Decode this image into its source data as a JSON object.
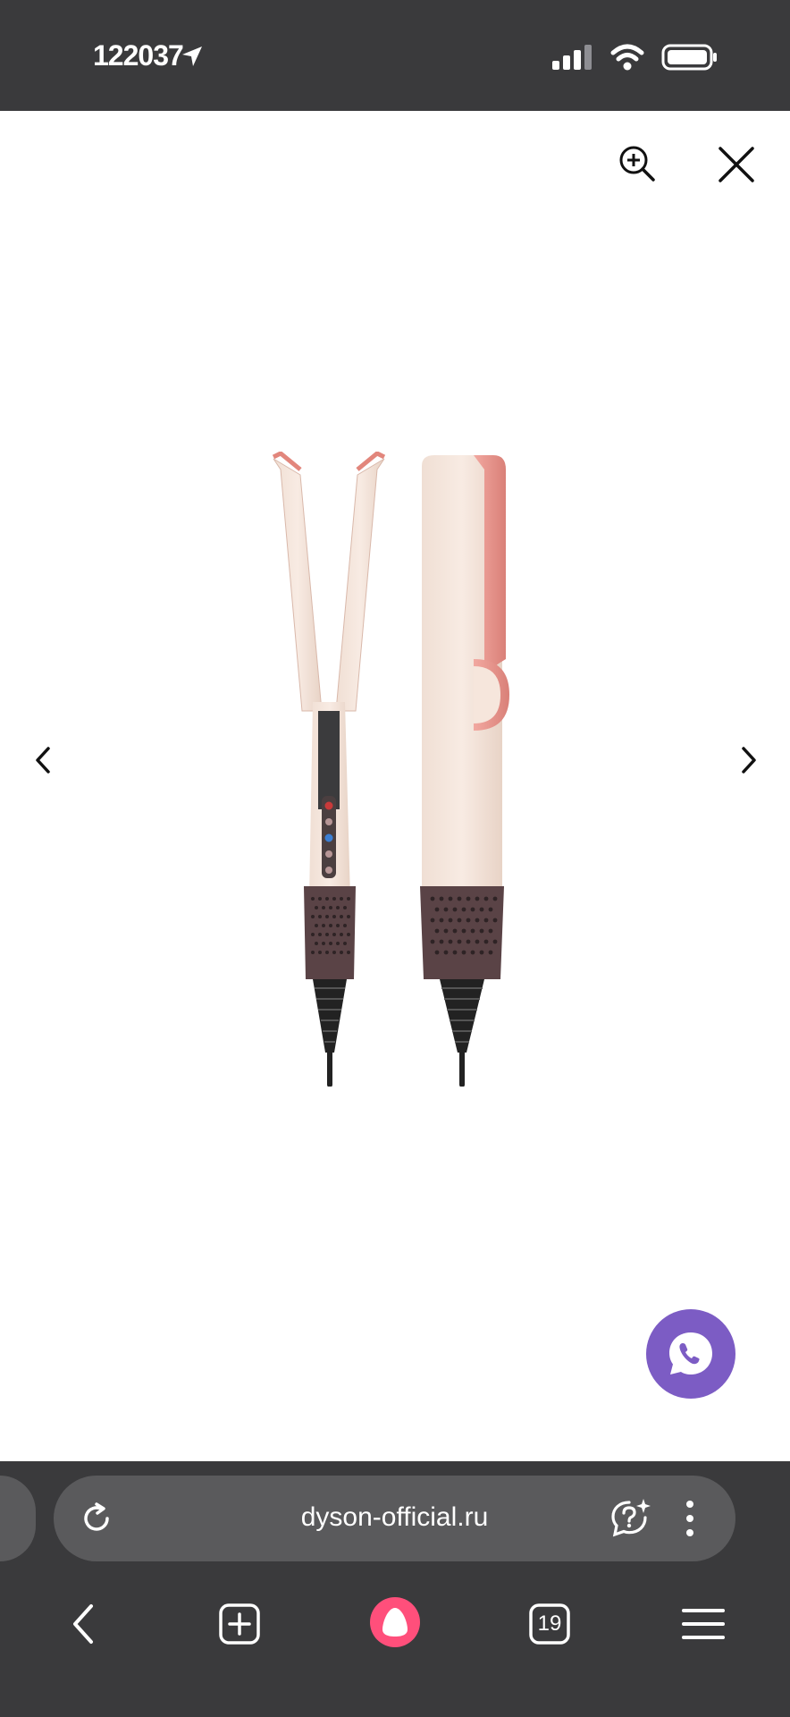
{
  "status_bar": {
    "time": "122037",
    "icons": [
      "location-arrow-icon",
      "signal-icon",
      "wifi-icon",
      "battery-icon"
    ]
  },
  "viewer": {
    "zoom_button": "zoom-in-icon",
    "close_button": "close-icon",
    "prev_button": "chevron-left-icon",
    "next_button": "chevron-right-icon",
    "product_image": "Dyson hair straightener pink/ceramic",
    "chat_button": "whatsapp-phone-icon"
  },
  "browser": {
    "url": "dyson-official.ru",
    "tab_count": "19",
    "icons": [
      "reload-icon",
      "assistant-question-icon",
      "more-vertical-icon",
      "back-icon",
      "new-tab-icon",
      "alice-icon",
      "tabs-icon",
      "menu-icon"
    ]
  },
  "colors": {
    "bar_bg": "#3a3a3c",
    "url_bg": "#5a5a5c",
    "fab_purple": "#7c5cc4",
    "alice_pink": "#ff4f7b"
  }
}
